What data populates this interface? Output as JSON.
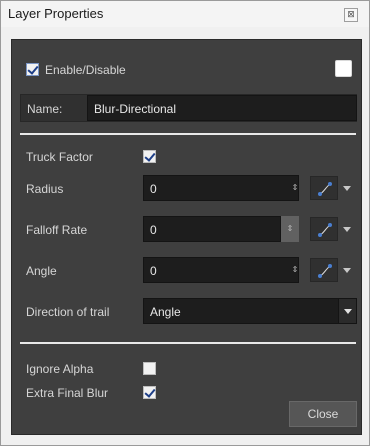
{
  "window": {
    "title": "Layer Properties",
    "close_glyph": "⊠"
  },
  "enable": {
    "label": "Enable/Disable",
    "checked": true
  },
  "name": {
    "label": "Name:",
    "value": "Blur-Directional"
  },
  "truck_factor": {
    "label": "Truck Factor",
    "checked": true
  },
  "radius": {
    "label": "Radius",
    "value": "0",
    "spinner_glyph": "⇕"
  },
  "falloff_rate": {
    "label": "Falloff Rate",
    "value": "0",
    "spinner_glyph": "⇕"
  },
  "angle": {
    "label": "Angle",
    "value": "0",
    "spinner_glyph": "⇕"
  },
  "direction_of_trail": {
    "label": "Direction of trail",
    "selected": "Angle"
  },
  "ignore_alpha": {
    "label": "Ignore Alpha",
    "checked": false
  },
  "extra_final_blur": {
    "label": "Extra Final Blur",
    "checked": true
  },
  "close_button": {
    "label": "Close"
  },
  "icons": {
    "function_curve": "function-curve-icon",
    "dropdown_caret": "chevron-down-icon"
  },
  "colors": {
    "panel_bg": "#3f3f3f",
    "field_bg": "#1d1d1d",
    "check_mark": "#1e3f88",
    "curve_start": "#4a7fd1",
    "curve_end": "#4a7fd1"
  }
}
